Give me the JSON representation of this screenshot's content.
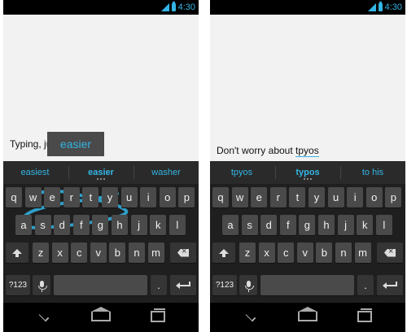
{
  "status_bar": {
    "time": "4:30",
    "accent": "#33b5e5"
  },
  "left": {
    "text": "Typing, jus",
    "preview": "easier",
    "suggestions": [
      "easiest",
      "easier",
      "washer"
    ]
  },
  "right": {
    "text": "Don't worry about ",
    "composing": "tpyos",
    "suggestions": [
      "tpyos",
      "typos",
      "to his"
    ]
  },
  "keyboard": {
    "row1": [
      "q",
      "w",
      "e",
      "r",
      "t",
      "y",
      "u",
      "i",
      "o",
      "p"
    ],
    "row2": [
      "a",
      "s",
      "d",
      "f",
      "g",
      "h",
      "j",
      "k",
      "l"
    ],
    "row3": [
      "z",
      "x",
      "c",
      "v",
      "b",
      "n",
      "m"
    ],
    "symbols_label": "?123",
    "period": "."
  },
  "icons": {
    "shift": "shift-icon",
    "backspace": "backspace-icon",
    "mic": "mic-icon",
    "enter": "enter-icon",
    "back": "back-icon",
    "home": "home-icon",
    "recents": "recents-icon"
  }
}
